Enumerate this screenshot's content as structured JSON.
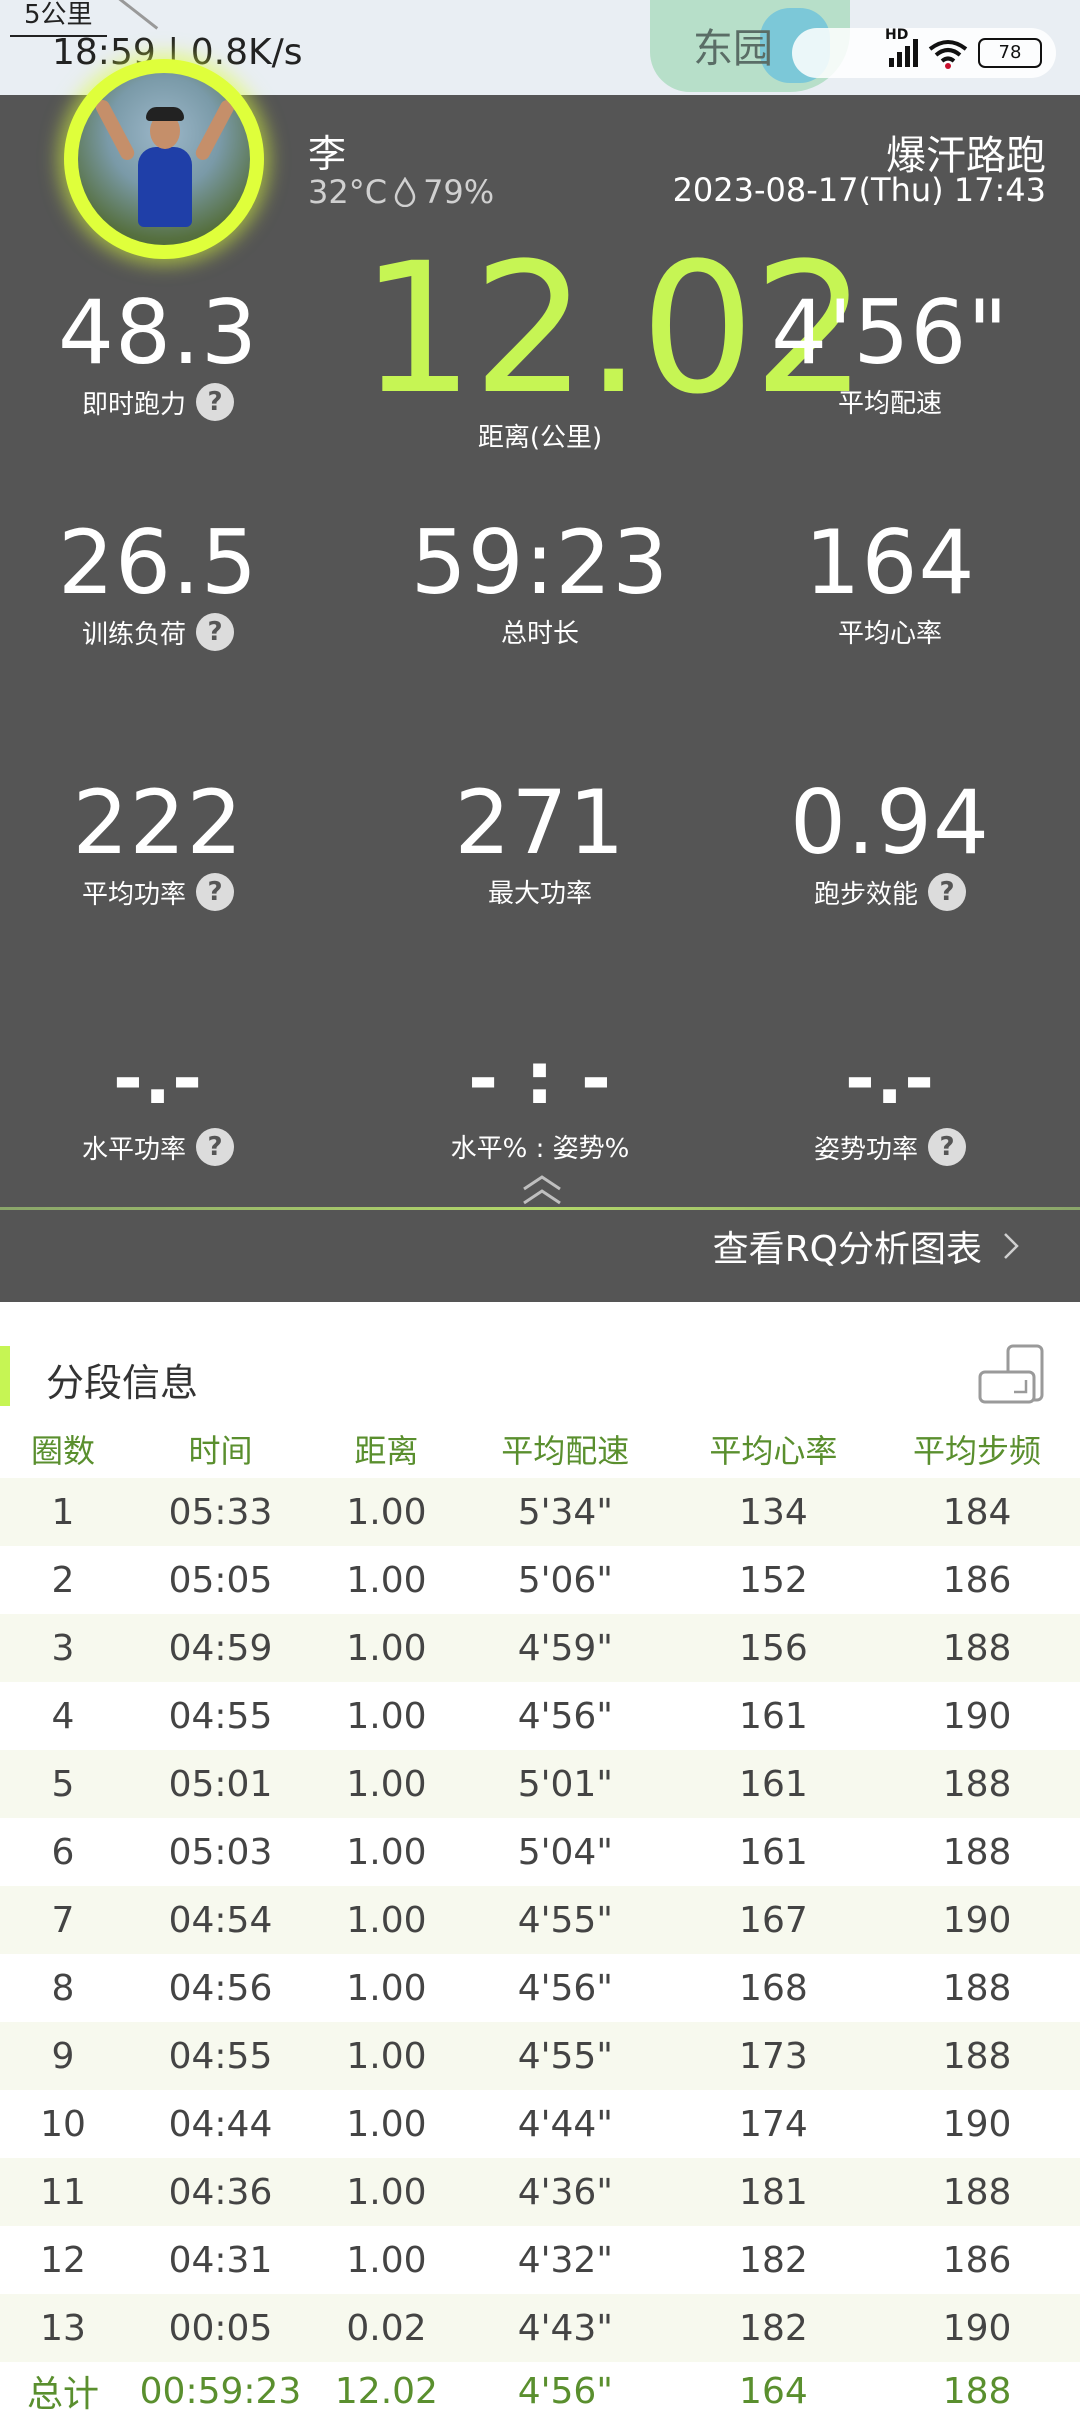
{
  "status_bar": {
    "time_speed": "18:59 | 0.8K/s",
    "battery": "78",
    "hd": "HD"
  },
  "map": {
    "scale": "5公里",
    "label": "东园"
  },
  "header": {
    "user_name": "李",
    "temperature": "32°C",
    "humidity": "79%",
    "run_type": "爆汗路跑",
    "datetime": "2023-08-17(Thu) 17:43"
  },
  "stats": {
    "instant_power": {
      "value": "48.3",
      "label": "即时跑力"
    },
    "distance": {
      "value": "12.02",
      "label": "距离(公里)"
    },
    "avg_pace": {
      "value": "4'56\"",
      "label": "平均配速"
    },
    "training_load": {
      "value": "26.5",
      "label": "训练负荷"
    },
    "total_time": {
      "value": "59:23",
      "label": "总时长"
    },
    "avg_hr": {
      "value": "164",
      "label": "平均心率"
    },
    "avg_power": {
      "value": "222",
      "label": "平均功率"
    },
    "max_power": {
      "value": "271",
      "label": "最大功率"
    },
    "running_efficiency": {
      "value": "0.94",
      "label": "跑步效能"
    },
    "horizontal_power": {
      "value": "-.-",
      "label": "水平功率"
    },
    "h_ratio": {
      "value": "- : -",
      "label": "水平% : 姿势%"
    },
    "form_power": {
      "value": "-.-",
      "label": "姿势功率"
    }
  },
  "rq_link": "查看RQ分析图表",
  "segments": {
    "title": "分段信息",
    "columns": [
      "圈数",
      "时间",
      "距离",
      "平均配速",
      "平均心率",
      "平均步频"
    ],
    "rows": [
      [
        "1",
        "05:33",
        "1.00",
        "5'34\"",
        "134",
        "184"
      ],
      [
        "2",
        "05:05",
        "1.00",
        "5'06\"",
        "152",
        "186"
      ],
      [
        "3",
        "04:59",
        "1.00",
        "4'59\"",
        "156",
        "188"
      ],
      [
        "4",
        "04:55",
        "1.00",
        "4'56\"",
        "161",
        "190"
      ],
      [
        "5",
        "05:01",
        "1.00",
        "5'01\"",
        "161",
        "188"
      ],
      [
        "6",
        "05:03",
        "1.00",
        "5'04\"",
        "161",
        "188"
      ],
      [
        "7",
        "04:54",
        "1.00",
        "4'55\"",
        "167",
        "190"
      ],
      [
        "8",
        "04:56",
        "1.00",
        "4'56\"",
        "168",
        "188"
      ],
      [
        "9",
        "04:55",
        "1.00",
        "4'55\"",
        "173",
        "188"
      ],
      [
        "10",
        "04:44",
        "1.00",
        "4'44\"",
        "174",
        "190"
      ],
      [
        "11",
        "04:36",
        "1.00",
        "4'36\"",
        "181",
        "188"
      ],
      [
        "12",
        "04:31",
        "1.00",
        "4'32\"",
        "182",
        "186"
      ],
      [
        "13",
        "00:05",
        "0.02",
        "4'43\"",
        "182",
        "190"
      ]
    ],
    "total": [
      "总计",
      "00:59:23",
      "12.02",
      "4'56\"",
      "164",
      "188"
    ]
  },
  "colors": {
    "panel_bg": "#555555",
    "accent_green": "#c6f554",
    "header_green": "#5a8f2e",
    "avatar_ring": "#dfff3b"
  }
}
